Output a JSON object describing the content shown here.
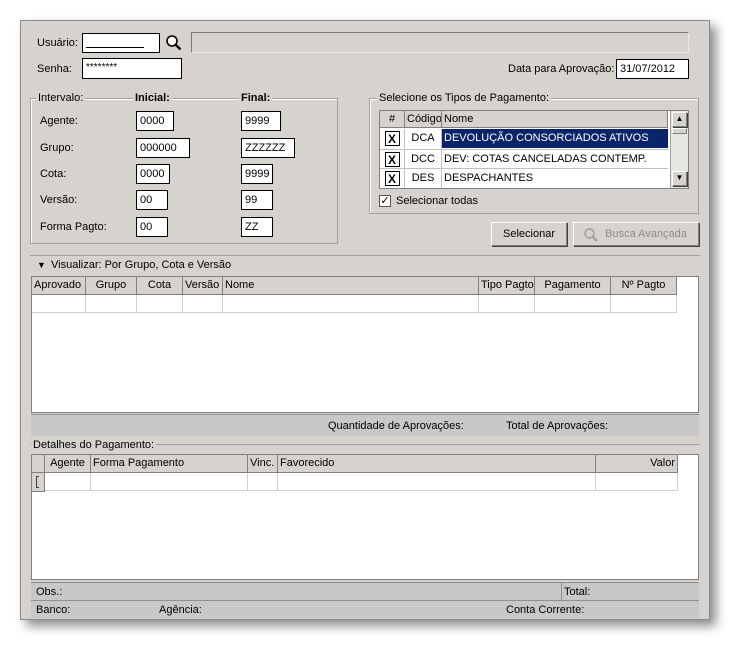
{
  "login": {
    "user_label": "Usuário:",
    "user_value": "",
    "user_name_display": "",
    "password_label": "Senha:",
    "password_value": "********",
    "approval_date_label": "Data para Aprovação:",
    "approval_date_value": "31/07/2012"
  },
  "interval": {
    "title": "Intervalo:",
    "initial_header": "Inicial:",
    "final_header": "Final:",
    "rows": [
      {
        "label": "Agente:",
        "initial": "0000",
        "final": "9999"
      },
      {
        "label": "Grupo:",
        "initial": "000000",
        "final": "ZZZZZZ"
      },
      {
        "label": "Cota:",
        "initial": "0000",
        "final": "9999"
      },
      {
        "label": "Versão:",
        "initial": "00",
        "final": "99"
      },
      {
        "label": "Forma Pagto:",
        "initial": "00",
        "final": "ZZ"
      }
    ]
  },
  "payment_types": {
    "title": "Selecione os Tipos de Pagamento:",
    "columns": [
      "#",
      "Código",
      "Nome"
    ],
    "rows": [
      {
        "checked": "X",
        "code": "DCA",
        "name": "DEVOLUÇÃO CONSORCIADOS ATIVOS"
      },
      {
        "checked": "X",
        "code": "DCC",
        "name": "DEV: COTAS CANCELADAS CONTEMP."
      },
      {
        "checked": "X",
        "code": "DES",
        "name": "DESPACHANTES"
      }
    ],
    "select_all_label": "Selecionar todas",
    "select_all_checked": "✓"
  },
  "buttons": {
    "select_label": "Selecionar",
    "advanced_search_label": "Busca Avançada"
  },
  "approvals": {
    "view_label": "Visualizar: Por Grupo, Cota e Versão",
    "columns": [
      "Aprovado",
      "Grupo",
      "Cota",
      "Versão",
      "Nome",
      "Tipo Pagto",
      "Pagamento",
      "Nº Pagto"
    ],
    "quantity_label": "Quantidade de Aprovações:",
    "total_label": "Total de Aprovações:"
  },
  "payment_details": {
    "title": "Detalhes do Pagamento:",
    "columns": [
      "Agente",
      "Forma Pagamento",
      "Vinc.",
      "Favorecido",
      "Valor"
    ],
    "obs_label": "Obs.:",
    "total_label": "Total:",
    "bank_label": "Banco:",
    "agency_label": "Agência:",
    "account_label": "Conta Corrente:"
  },
  "colors": {
    "selection": "#0a246a",
    "panel": "#d6d3ce"
  }
}
